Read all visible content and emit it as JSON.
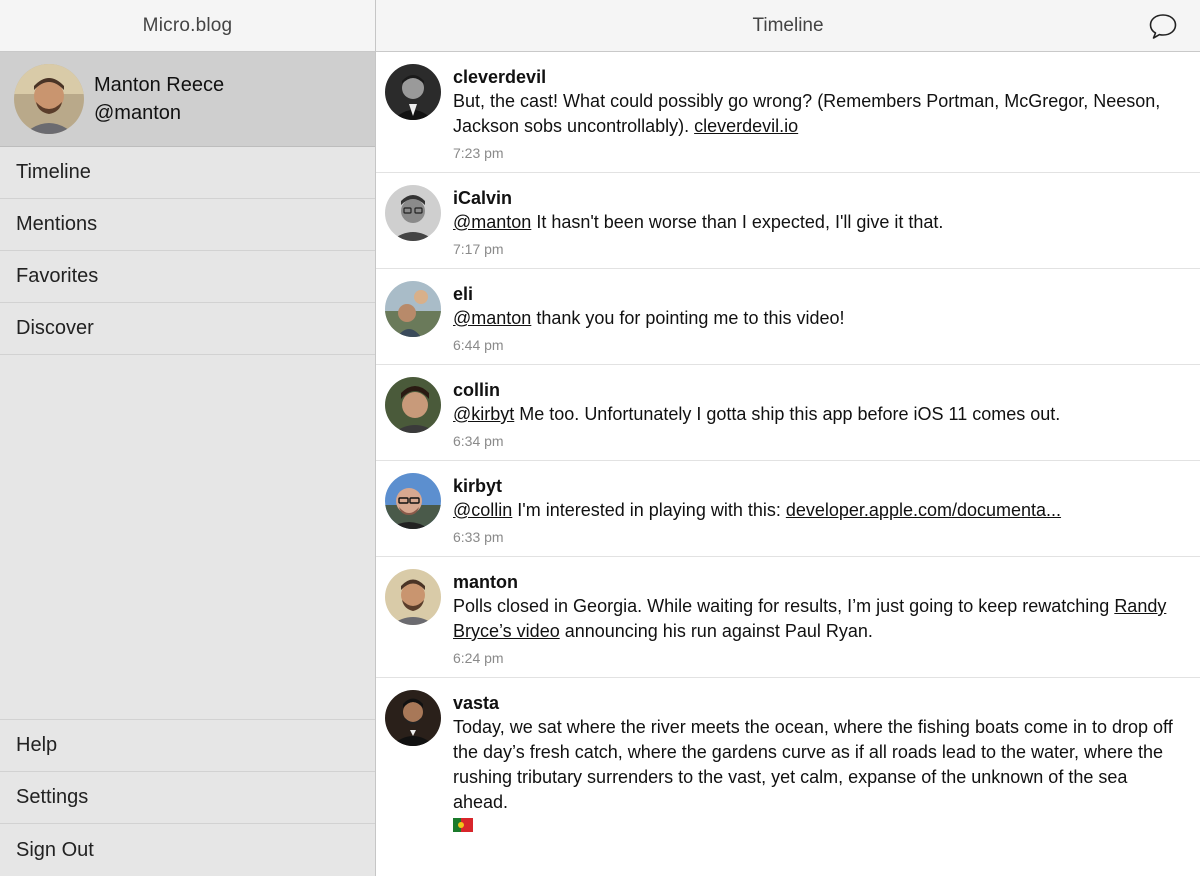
{
  "sidebar": {
    "title": "Micro.blog",
    "profile": {
      "name": "Manton Reece",
      "handle": "@manton"
    },
    "nav": [
      {
        "label": "Timeline"
      },
      {
        "label": "Mentions"
      },
      {
        "label": "Favorites"
      },
      {
        "label": "Discover"
      }
    ],
    "bottom_nav": [
      {
        "label": "Help"
      },
      {
        "label": "Settings"
      },
      {
        "label": "Sign Out"
      }
    ]
  },
  "header": {
    "title": "Timeline",
    "compose_icon": "speech-bubble-icon"
  },
  "posts": [
    {
      "user": "cleverdevil",
      "text": "But, the cast! What could possibly go wrong? (Remembers Portman, McGregor, Neeson, Jackson sobs uncontrollably). ",
      "link": "cleverdevil.io",
      "time": "7:23 pm",
      "avatar_color": "#555555"
    },
    {
      "user": "iCalvin",
      "mention": "@manton",
      "text": " It hasn't been worse than I expected, I'll give it that.",
      "time": "7:17 pm",
      "avatar_color": "#6b6b6b"
    },
    {
      "user": "eli",
      "mention": "@manton",
      "text": " thank you for pointing me to this video!",
      "time": "6:44 pm",
      "avatar_color": "#7a8a6a"
    },
    {
      "user": "collin",
      "mention": "@kirbyt",
      "text": " Me too. Unfortunately I gotta ship this app before iOS 11 comes out.",
      "time": "6:34 pm",
      "avatar_color": "#5a6a4a"
    },
    {
      "user": "kirbyt",
      "mention": "@collin",
      "text": " I'm interested in playing with this: ",
      "link": "developer.apple.com/documenta...",
      "time": "6:33 pm",
      "avatar_color": "#3a6fb0"
    },
    {
      "user": "manton",
      "text": "Polls closed in Georgia. While waiting for results, I’m just going to keep rewatching ",
      "link": "Randy Bryce’s video",
      "text_after": " announcing his run against Paul Ryan.",
      "time": "6:24 pm",
      "avatar_color": "#8a6a4a"
    },
    {
      "user": "vasta",
      "text": "Today, we sat where the river meets the ocean, where the fishing boats come in to drop off the day’s fresh catch, where the gardens curve as if all roads lead to the water, where the rushing tributary surrenders to the vast, yet calm, expanse of the unknown of the sea ahead.",
      "flag_icon": "portugal-flag-icon",
      "avatar_color": "#3a2a22"
    }
  ]
}
